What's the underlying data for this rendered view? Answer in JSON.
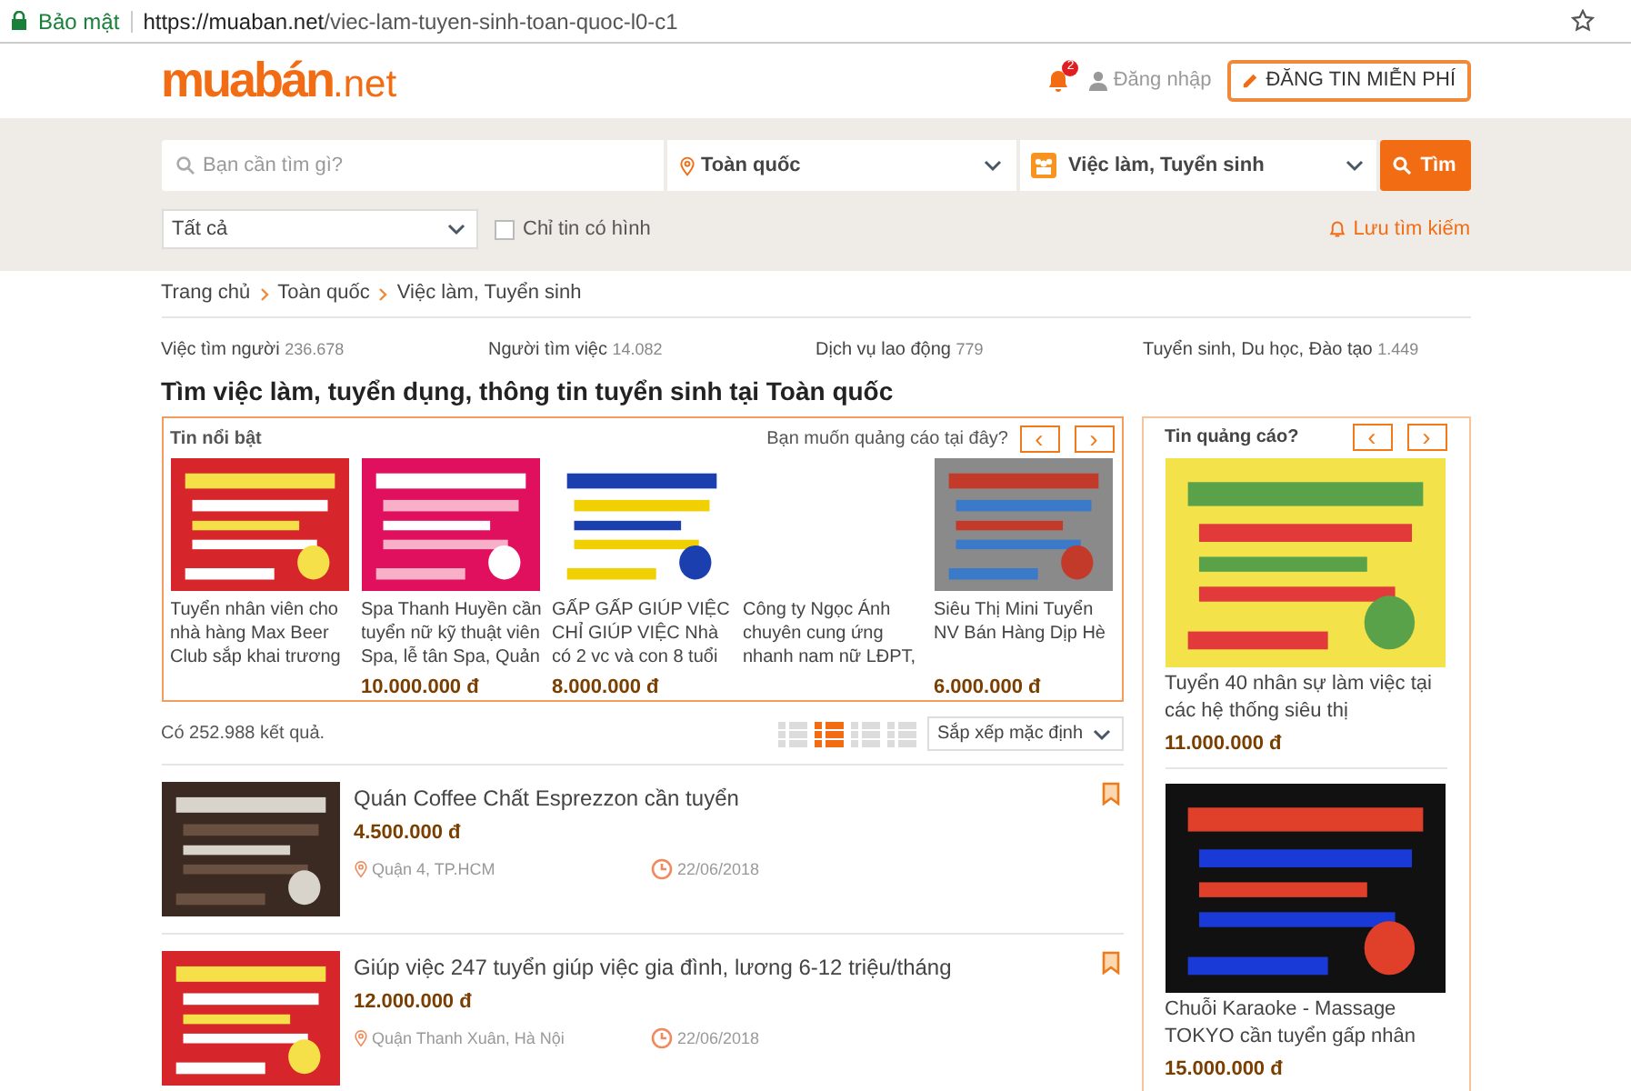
{
  "browser": {
    "security": "Bảo mật",
    "url_host": "https://muaban.net",
    "url_path": "/viec-lam-tuyen-sinh-toan-quoc-l0-c1"
  },
  "header": {
    "logo_main": "muabán",
    "logo_tld": ".net",
    "notification_count": "2",
    "login": "Đăng nhập",
    "post_button": "ĐĂNG TIN MIỄN PHÍ"
  },
  "search": {
    "placeholder": "Bạn cần tìm gì?",
    "location": "Toàn quốc",
    "category": "Việc làm, Tuyển sinh",
    "button": "Tìm",
    "filter": "Tất cả",
    "images_only": {
      "label": "Chỉ tin có hình",
      "checked": false
    },
    "save_search": "Lưu tìm kiếm"
  },
  "breadcrumbs": [
    "Trang chủ",
    "Toàn quốc",
    "Việc làm, Tuyển sinh"
  ],
  "categories": [
    {
      "name": "Việc tìm người",
      "count": "236.678"
    },
    {
      "name": "Người tìm việc",
      "count": "14.082"
    },
    {
      "name": "Dịch vụ lao động",
      "count": "779"
    },
    {
      "name": "Tuyển sinh, Du học, Đào tạo",
      "count": "1.449"
    }
  ],
  "page_title": "Tìm việc làm, tuyển dụng, thông tin tuyển sinh tại Toàn quốc",
  "featured": {
    "title": "Tin nổi bật",
    "advertise_link": "Bạn muốn quảng cáo tại đây?",
    "prev": "‹",
    "next": "›",
    "items": [
      {
        "title": "Tuyển nhân viên cho nhà hàng Max Beer Club sắp khai trương"
      },
      {
        "title": "Spa Thanh Huyền cần tuyển nữ kỹ thuật viên Spa, lễ tân Spa, Quản",
        "price": "10.000.000 đ"
      },
      {
        "title": "GẤP GẤP GIÚP VIỆC CHỈ GIÚP VIỆC Nhà có 2 vc và con 8 tuổi",
        "price": "8.000.000 đ"
      },
      {
        "kind": "text",
        "title": "Công ty Ngọc Ánh chuyên cung ứng nhanh nam nữ LĐPT,"
      },
      {
        "title": "Siêu Thị Mini Tuyển NV Bán Hàng Dịp Hè",
        "price": "6.000.000 đ"
      }
    ]
  },
  "results": {
    "count": "Có 252.988 kết quả.",
    "views": [
      {
        "selected": false
      },
      {
        "selected": true
      },
      {
        "selected": false
      },
      {
        "selected": false
      }
    ],
    "sort": "Sắp xếp mặc định",
    "rows": [
      {
        "title": "Quán Coffee Chất Esprezzon cần tuyển",
        "price": "4.500.000 đ",
        "location": "Quận 4, TP.HCM",
        "date": "22/06/2018"
      },
      {
        "title": "Giúp việc 247 tuyển giúp việc gia đình, lương 6-12 triệu/tháng",
        "price": "12.000.000 đ",
        "location": "Quận Thanh Xuân, Hà Nội",
        "date": "22/06/2018"
      }
    ]
  },
  "ads": {
    "title": "Tin quảng cáo?",
    "prev": "‹",
    "next": "›",
    "items": [
      {
        "title": "Tuyển 40 nhân sự làm việc tại các hệ thống siêu thị",
        "price": "11.000.000 đ"
      },
      {
        "title": "Chuỗi Karaoke - Massage TOKYO cần tuyển gấp nhân",
        "price": "15.000.000 đ"
      }
    ]
  }
}
